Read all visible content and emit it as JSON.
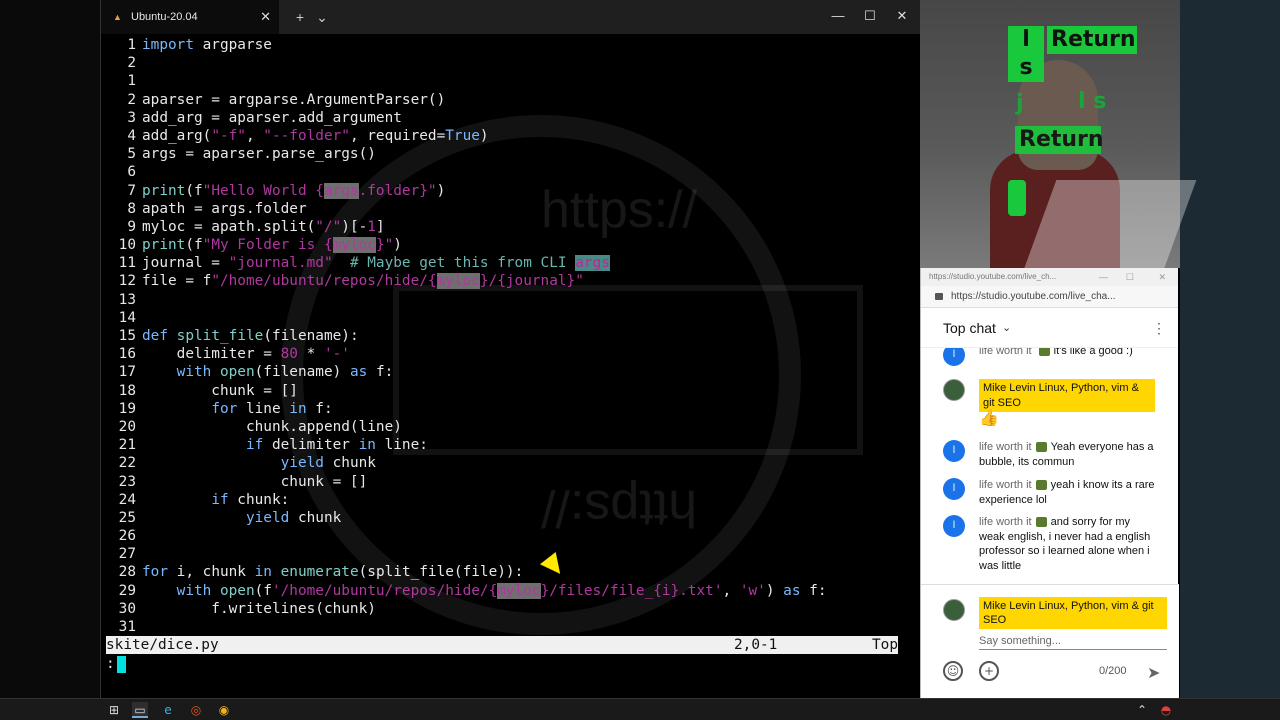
{
  "window": {
    "tab_title": "Ubuntu-20.04",
    "new_tab": "+",
    "dropdown": "⌄",
    "tab_close": "✕",
    "minimize": "—",
    "maximize": "☐",
    "close": "✕"
  },
  "watermark": {
    "text_top": "https://",
    "text_bottom": "https://"
  },
  "editor": {
    "lines": [
      {
        "n": "1",
        "parts": [
          [
            "kw",
            "import"
          ],
          [
            "",
            " argparse"
          ]
        ]
      },
      {
        "n": "2",
        "parts": []
      },
      {
        "n": "1",
        "parts": []
      },
      {
        "n": "2",
        "parts": [
          [
            "",
            "aparser = argparse.ArgumentParser()"
          ]
        ]
      },
      {
        "n": "3",
        "parts": [
          [
            "",
            "add_arg = aparser.add_argument"
          ]
        ]
      },
      {
        "n": "4",
        "parts": [
          [
            "",
            "add_arg("
          ],
          [
            "st",
            "\"-f\""
          ],
          [
            "",
            ", "
          ],
          [
            "st",
            "\"--folder\""
          ],
          [
            "",
            ", required="
          ],
          [
            "kw",
            "True"
          ],
          [
            "",
            ")"
          ]
        ]
      },
      {
        "n": "5",
        "parts": [
          [
            "",
            "args = aparser.parse_args()"
          ]
        ]
      },
      {
        "n": "6",
        "parts": []
      },
      {
        "n": "7",
        "parts": [
          [
            "fn",
            "print"
          ],
          [
            "",
            "(f"
          ],
          [
            "st",
            "\"Hello World {"
          ],
          [
            "hl",
            "args"
          ],
          [
            "st",
            ".folder}\""
          ],
          [
            "",
            ")"
          ]
        ]
      },
      {
        "n": "8",
        "parts": [
          [
            "",
            "apath = args.folder"
          ]
        ]
      },
      {
        "n": "9",
        "parts": [
          [
            "",
            "myloc = apath.split("
          ],
          [
            "st",
            "\"/\""
          ],
          [
            "",
            ")[-"
          ],
          [
            "num",
            "1"
          ],
          [
            "",
            "]"
          ]
        ]
      },
      {
        "n": "10",
        "parts": [
          [
            "fn",
            "print"
          ],
          [
            "",
            "(f"
          ],
          [
            "st",
            "\"My Folder is {"
          ],
          [
            "hl",
            "myloc"
          ],
          [
            "st",
            "}\""
          ],
          [
            "",
            ")"
          ]
        ]
      },
      {
        "n": "11",
        "parts": [
          [
            "",
            "journal = "
          ],
          [
            "st",
            "\"journal.md\""
          ],
          [
            "",
            "  "
          ],
          [
            "cm",
            "# Maybe get this from CLI "
          ],
          [
            "ch",
            "args"
          ]
        ]
      },
      {
        "n": "12",
        "parts": [
          [
            "",
            "file = f"
          ],
          [
            "st",
            "\"/home/ubuntu/repos/hide/{"
          ],
          [
            "hl",
            "myloc"
          ],
          [
            "st",
            "}/{journal}\""
          ]
        ]
      },
      {
        "n": "13",
        "parts": []
      },
      {
        "n": "14",
        "parts": []
      },
      {
        "n": "15",
        "parts": [
          [
            "kw",
            "def"
          ],
          [
            "",
            " "
          ],
          [
            "fn",
            "split_file"
          ],
          [
            "",
            "(filename):"
          ]
        ]
      },
      {
        "n": "16",
        "parts": [
          [
            "",
            "    delimiter = "
          ],
          [
            "num",
            "80"
          ],
          [
            "",
            " * "
          ],
          [
            "st",
            "'-'"
          ]
        ]
      },
      {
        "n": "17",
        "parts": [
          [
            "",
            "    "
          ],
          [
            "kw",
            "with"
          ],
          [
            "",
            " "
          ],
          [
            "fn",
            "open"
          ],
          [
            "",
            "(filename) "
          ],
          [
            "kw",
            "as"
          ],
          [
            "",
            " f:"
          ]
        ]
      },
      {
        "n": "18",
        "parts": [
          [
            "",
            "        chunk = []"
          ]
        ]
      },
      {
        "n": "19",
        "parts": [
          [
            "",
            "        "
          ],
          [
            "kw",
            "for"
          ],
          [
            "",
            " line "
          ],
          [
            "kw",
            "in"
          ],
          [
            "",
            " f:"
          ]
        ]
      },
      {
        "n": "20",
        "parts": [
          [
            "",
            "            chunk.append(line)"
          ]
        ]
      },
      {
        "n": "21",
        "parts": [
          [
            "",
            "            "
          ],
          [
            "kw",
            "if"
          ],
          [
            "",
            " delimiter "
          ],
          [
            "kw",
            "in"
          ],
          [
            "",
            " line:"
          ]
        ]
      },
      {
        "n": "22",
        "parts": [
          [
            "",
            "                "
          ],
          [
            "kw",
            "yield"
          ],
          [
            "",
            " chunk"
          ]
        ]
      },
      {
        "n": "23",
        "parts": [
          [
            "",
            "                chunk = []"
          ]
        ]
      },
      {
        "n": "24",
        "parts": [
          [
            "",
            "        "
          ],
          [
            "kw",
            "if"
          ],
          [
            "",
            " chunk:"
          ]
        ]
      },
      {
        "n": "25",
        "parts": [
          [
            "",
            "            "
          ],
          [
            "kw",
            "yield"
          ],
          [
            "",
            " chunk"
          ]
        ]
      },
      {
        "n": "26",
        "parts": []
      },
      {
        "n": "27",
        "parts": []
      },
      {
        "n": "28",
        "parts": [
          [
            "kw",
            "for"
          ],
          [
            "",
            " i, chunk "
          ],
          [
            "kw",
            "in"
          ],
          [
            "",
            " "
          ],
          [
            "fn",
            "enumerate"
          ],
          [
            "",
            "(split_file(file)):"
          ]
        ]
      },
      {
        "n": "29",
        "parts": [
          [
            "",
            "    "
          ],
          [
            "kw",
            "with"
          ],
          [
            "",
            " "
          ],
          [
            "fn",
            "open"
          ],
          [
            "",
            "(f"
          ],
          [
            "st",
            "'/home/ubuntu/repos/hide/{"
          ],
          [
            "hl",
            "myloc"
          ],
          [
            "st",
            "}/files/file_{i}.txt'"
          ],
          [
            "",
            ", "
          ],
          [
            "st",
            "'w'"
          ],
          [
            "",
            ") "
          ],
          [
            "kw",
            "as"
          ],
          [
            "",
            " f:"
          ]
        ]
      },
      {
        "n": "30",
        "parts": [
          [
            "",
            "        f.writelines(chunk)"
          ]
        ]
      },
      {
        "n": "31",
        "parts": []
      }
    ],
    "status_file": "skite/dice.py",
    "status_pos": "2,0-1",
    "status_scroll": "Top",
    "cmdline": ":"
  },
  "webcam": {
    "key1": "l s",
    "key2": "Return",
    "key3": "j",
    "key4": "l s",
    "key5": "Return"
  },
  "browser": {
    "tab_title": "https://studio.youtube.com/live_ch...",
    "url": "https://studio.youtube.com/live_cha...",
    "chat_title": "Top chat",
    "chat_chevron": "⌄",
    "kebab": "⋮",
    "messages": [
      {
        "avatar": "l",
        "name": "life worth it",
        "text": "it's like a good :)"
      },
      {
        "avatar": "",
        "owner": "Mike Levin Linux, Python, vim & git SEO",
        "text": "👍"
      },
      {
        "avatar": "l",
        "name": "life worth it",
        "text": "Yeah everyone has a bubble, its commun"
      },
      {
        "avatar": "l",
        "name": "life worth it",
        "text": "yeah i know its a rare experience lol"
      },
      {
        "avatar": "l",
        "name": "life worth it",
        "text": "and sorry for my weak english, i never had a english professor so i learned alone when i was little"
      }
    ],
    "composer_name": "Mike Levin Linux, Python, vim & git SEO",
    "placeholder": "Say something...",
    "counter": "0/200",
    "emoji_btn": "☺",
    "plus_btn": "+",
    "send_btn": "➤"
  },
  "taskbar": {
    "start": "⊞",
    "terminal": "▭",
    "edge": "e",
    "ubuntu": "◎",
    "chrome": "◉",
    "tray_up": "⌃",
    "tray_app": "◓"
  }
}
